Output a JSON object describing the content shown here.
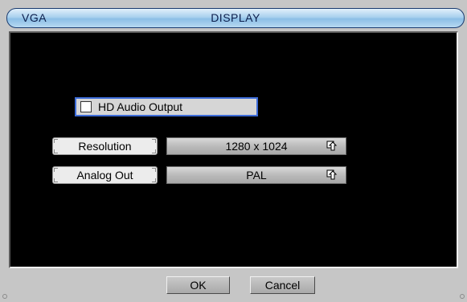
{
  "window": {
    "source_label": "VGA",
    "title": "DISPLAY"
  },
  "hd_audio": {
    "label": "HD Audio Output",
    "checked": false
  },
  "settings": [
    {
      "label": "Resolution",
      "value": "1280 x 1024",
      "icon": "dropdown-arrow-icon"
    },
    {
      "label": "Analog Out",
      "value": "PAL",
      "icon": "dropdown-arrow-icon"
    }
  ],
  "footer": {
    "ok_label": "OK",
    "cancel_label": "Cancel"
  },
  "colors": {
    "title_gradient": "#a9d0ee",
    "panel_bg": "#000000",
    "focus_border": "#3d6cd8",
    "window_bg": "#c6c6c6"
  }
}
